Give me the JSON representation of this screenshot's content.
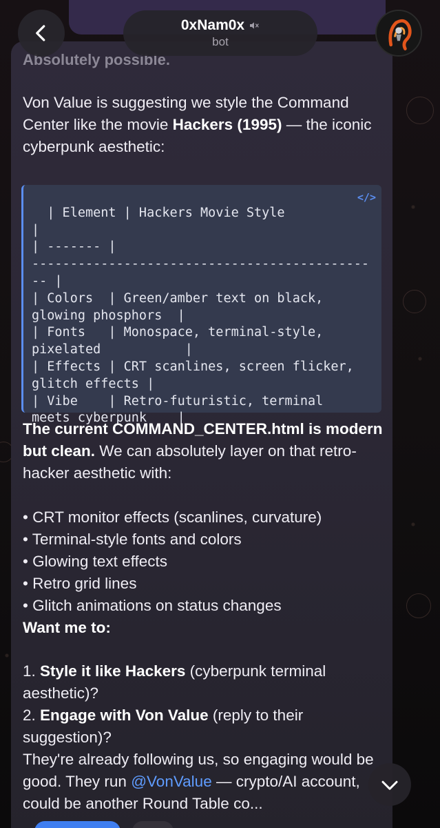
{
  "header": {
    "back_icon": "chevron-left-icon",
    "title": "0xNam0x",
    "mute_icon": "speaker-muted-icon",
    "subtitle": "bot",
    "avatar": "bot-avatar"
  },
  "message": {
    "faded_intro": "Absolutely possible.",
    "para1_prefix": "Von Value is suggesting we style the Command Center like the movie ",
    "para1_bold": "Hackers (1995)",
    "para1_suffix": " — the iconic cyberpunk aesthetic:",
    "code_icon": "</>",
    "code_text": "| Element | Hackers Movie Style\n|\n| ------- |\n--------------------------------------------\n-- |\n| Colors  | Green/amber text on black,\nglowing phosphors  |\n| Fonts   | Monospace, terminal-style,\npixelated           |\n| Effects | CRT scanlines, screen flicker,\nglitch effects |\n| Vibe    | Retro-futuristic, terminal\nmeets cyberpunk    |",
    "para2_bold": "The current COMMAND_CENTER.html is modern but clean.",
    "para2_rest": " We can absolutely layer on that retro-hacker aesthetic with:",
    "bullets": [
      "• CRT monitor effects (scanlines, curvature)",
      "• Terminal-style fonts and colors",
      "• Glowing text effects",
      "• Retro grid lines",
      "• Glitch animations on status changes"
    ],
    "want_label": "Want me to:",
    "option1_num": "1. ",
    "option1_bold": "Style it like Hackers",
    "option1_rest": " (cyberpunk terminal aesthetic)?",
    "option2_num": "2. ",
    "option2_bold": "Engage with Von Value",
    "option2_rest": " (reply to their suggestion)?",
    "closing_pre": "They're already following us, so engaging would be good. They run ",
    "closing_mention": "@VonValue",
    "closing_post": " — crypto/AI account, could be another Round Table co..."
  },
  "scroll_down_icon": "chevron-down-icon",
  "colors": {
    "bubble": "#2f2a3a",
    "code_bg": "#343a4e",
    "accent_blue": "#5b8ef0",
    "mention": "#5f9cff"
  }
}
